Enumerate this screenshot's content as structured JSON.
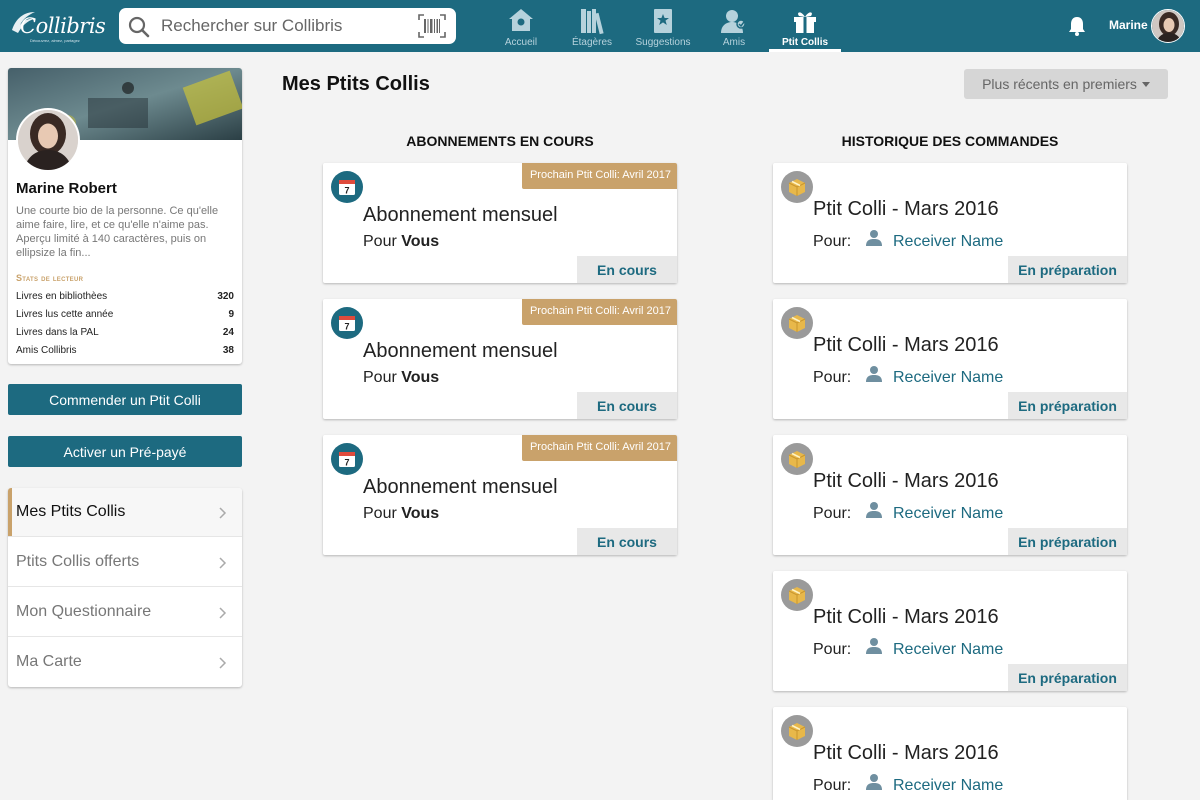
{
  "header": {
    "logo_text": "Collibris",
    "logo_tagline": "Découvrez, aimez, partagez",
    "search_placeholder": "Rechercher sur Collibris",
    "nav": [
      {
        "label": "Accueil",
        "icon": "house-icon"
      },
      {
        "label": "Étagères",
        "icon": "books-icon"
      },
      {
        "label": "Suggestions",
        "icon": "suggestion-book-icon"
      },
      {
        "label": "Amis",
        "icon": "friends-icon"
      },
      {
        "label": "Ptit Collis",
        "icon": "gift-icon",
        "active": true
      }
    ],
    "user_name": "Marine"
  },
  "profile": {
    "name": "Marine Robert",
    "bio": "Une courte bio de la personne. Ce qu'elle aime faire, lire, et ce qu'elle n'aime pas. Aperçu limité à 140 caractères, puis on ellipsize la fin...",
    "stats_title": "Stats de lecteur",
    "stats": [
      {
        "label": "Livres en bibliothèes",
        "value": "320"
      },
      {
        "label": "Livres lus cette année",
        "value": "9"
      },
      {
        "label": "Livres dans la PAL",
        "value": "24"
      },
      {
        "label": "Amis Collibris",
        "value": "38"
      }
    ]
  },
  "actions": {
    "order_label": "Commender un Ptit Colli",
    "activate_label": "Activer un Pré-payé"
  },
  "menu": [
    {
      "label": "Mes Ptits Collis",
      "active": true
    },
    {
      "label": "Ptits Collis offerts"
    },
    {
      "label": "Mon Questionnaire"
    },
    {
      "label": "Ma Carte"
    }
  ],
  "main": {
    "title": "Mes Ptits Collis",
    "sort_label": "Plus récents en premiers",
    "subscriptions_heading": "ABONNEMENTS EN COURS",
    "orders_heading": "HISTORIQUE DES COMMANDES",
    "subscriptions": [
      {
        "badge": "Prochain Ptit Colli: Avril 2017",
        "title": "Abonnement mensuel",
        "for_prefix": "Pour",
        "for_who": "Vous",
        "status": "En cours",
        "calendar_day": "7"
      },
      {
        "badge": "Prochain Ptit Colli: Avril 2017",
        "title": "Abonnement mensuel",
        "for_prefix": "Pour",
        "for_who": "Vous",
        "status": "En cours",
        "calendar_day": "7"
      },
      {
        "badge": "Prochain Ptit Colli: Avril 2017",
        "title": "Abonnement mensuel",
        "for_prefix": "Pour",
        "for_who": "Vous",
        "status": "En cours",
        "calendar_day": "7"
      }
    ],
    "orders": [
      {
        "title": "Ptit Colli - Mars 2016",
        "for_label": "Pour:",
        "receiver": "Receiver Name",
        "status": "En préparation"
      },
      {
        "title": "Ptit Colli - Mars 2016",
        "for_label": "Pour:",
        "receiver": "Receiver Name",
        "status": "En préparation"
      },
      {
        "title": "Ptit Colli - Mars 2016",
        "for_label": "Pour:",
        "receiver": "Receiver Name",
        "status": "En préparation"
      },
      {
        "title": "Ptit Colli - Mars 2016",
        "for_label": "Pour:",
        "receiver": "Receiver Name",
        "status": "En préparation"
      },
      {
        "title": "Ptit Colli - Mars 2016",
        "for_label": "Pour:",
        "receiver": "Receiver Name",
        "status": "En préparation"
      }
    ]
  },
  "colors": {
    "brand_teal": "#1d6a80",
    "accent_gold": "#c9a26b",
    "background": "#f3f3f3"
  }
}
